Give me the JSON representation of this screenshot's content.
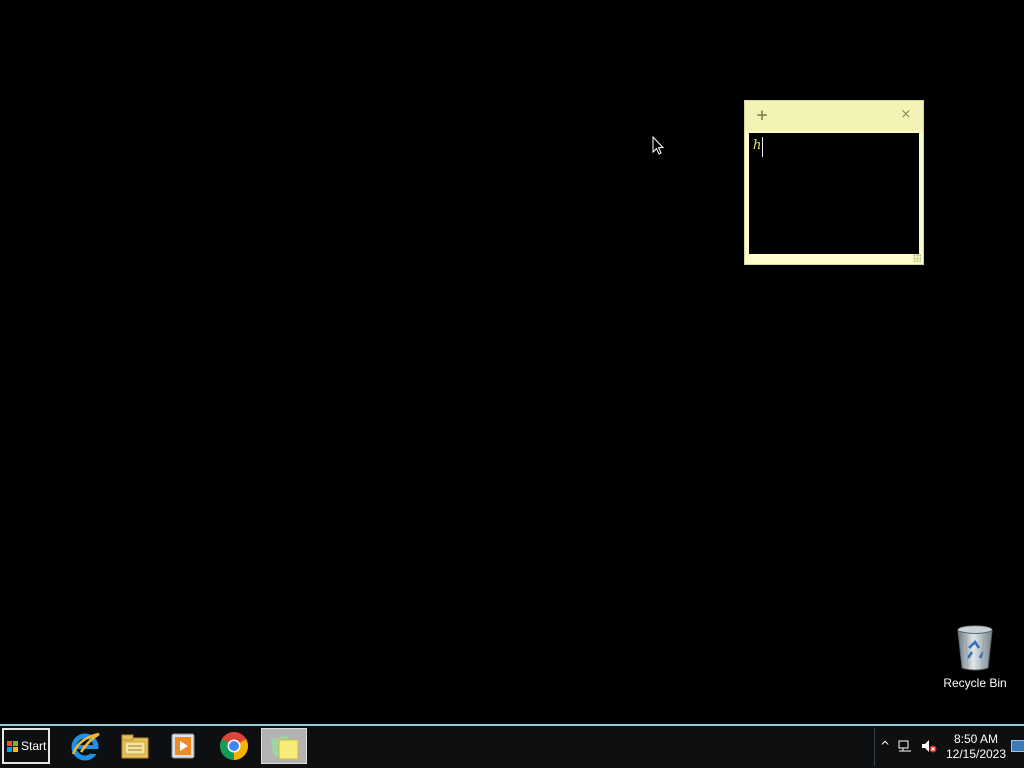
{
  "sticky_note": {
    "add_label": "+",
    "close_label": "×",
    "text": "h",
    "text_color": "#e2e07a",
    "background_color": "#fdfdc9"
  },
  "desktop": {
    "icons": [
      {
        "label": "Recycle Bin",
        "icon": "recycle-bin-icon"
      }
    ]
  },
  "taskbar": {
    "start_label": "Start",
    "pinned": [
      {
        "name": "Internet Explorer",
        "icon": "internet-explorer-icon"
      },
      {
        "name": "File Explorer",
        "icon": "file-explorer-icon"
      },
      {
        "name": "Media Player",
        "icon": "media-player-icon"
      },
      {
        "name": "Google Chrome",
        "icon": "chrome-icon"
      },
      {
        "name": "Sticky Notes",
        "icon": "sticky-notes-icon",
        "active": true
      }
    ],
    "tray": {
      "overflow_label": "^",
      "time": "8:50 AM",
      "date": "12/15/2023"
    }
  }
}
